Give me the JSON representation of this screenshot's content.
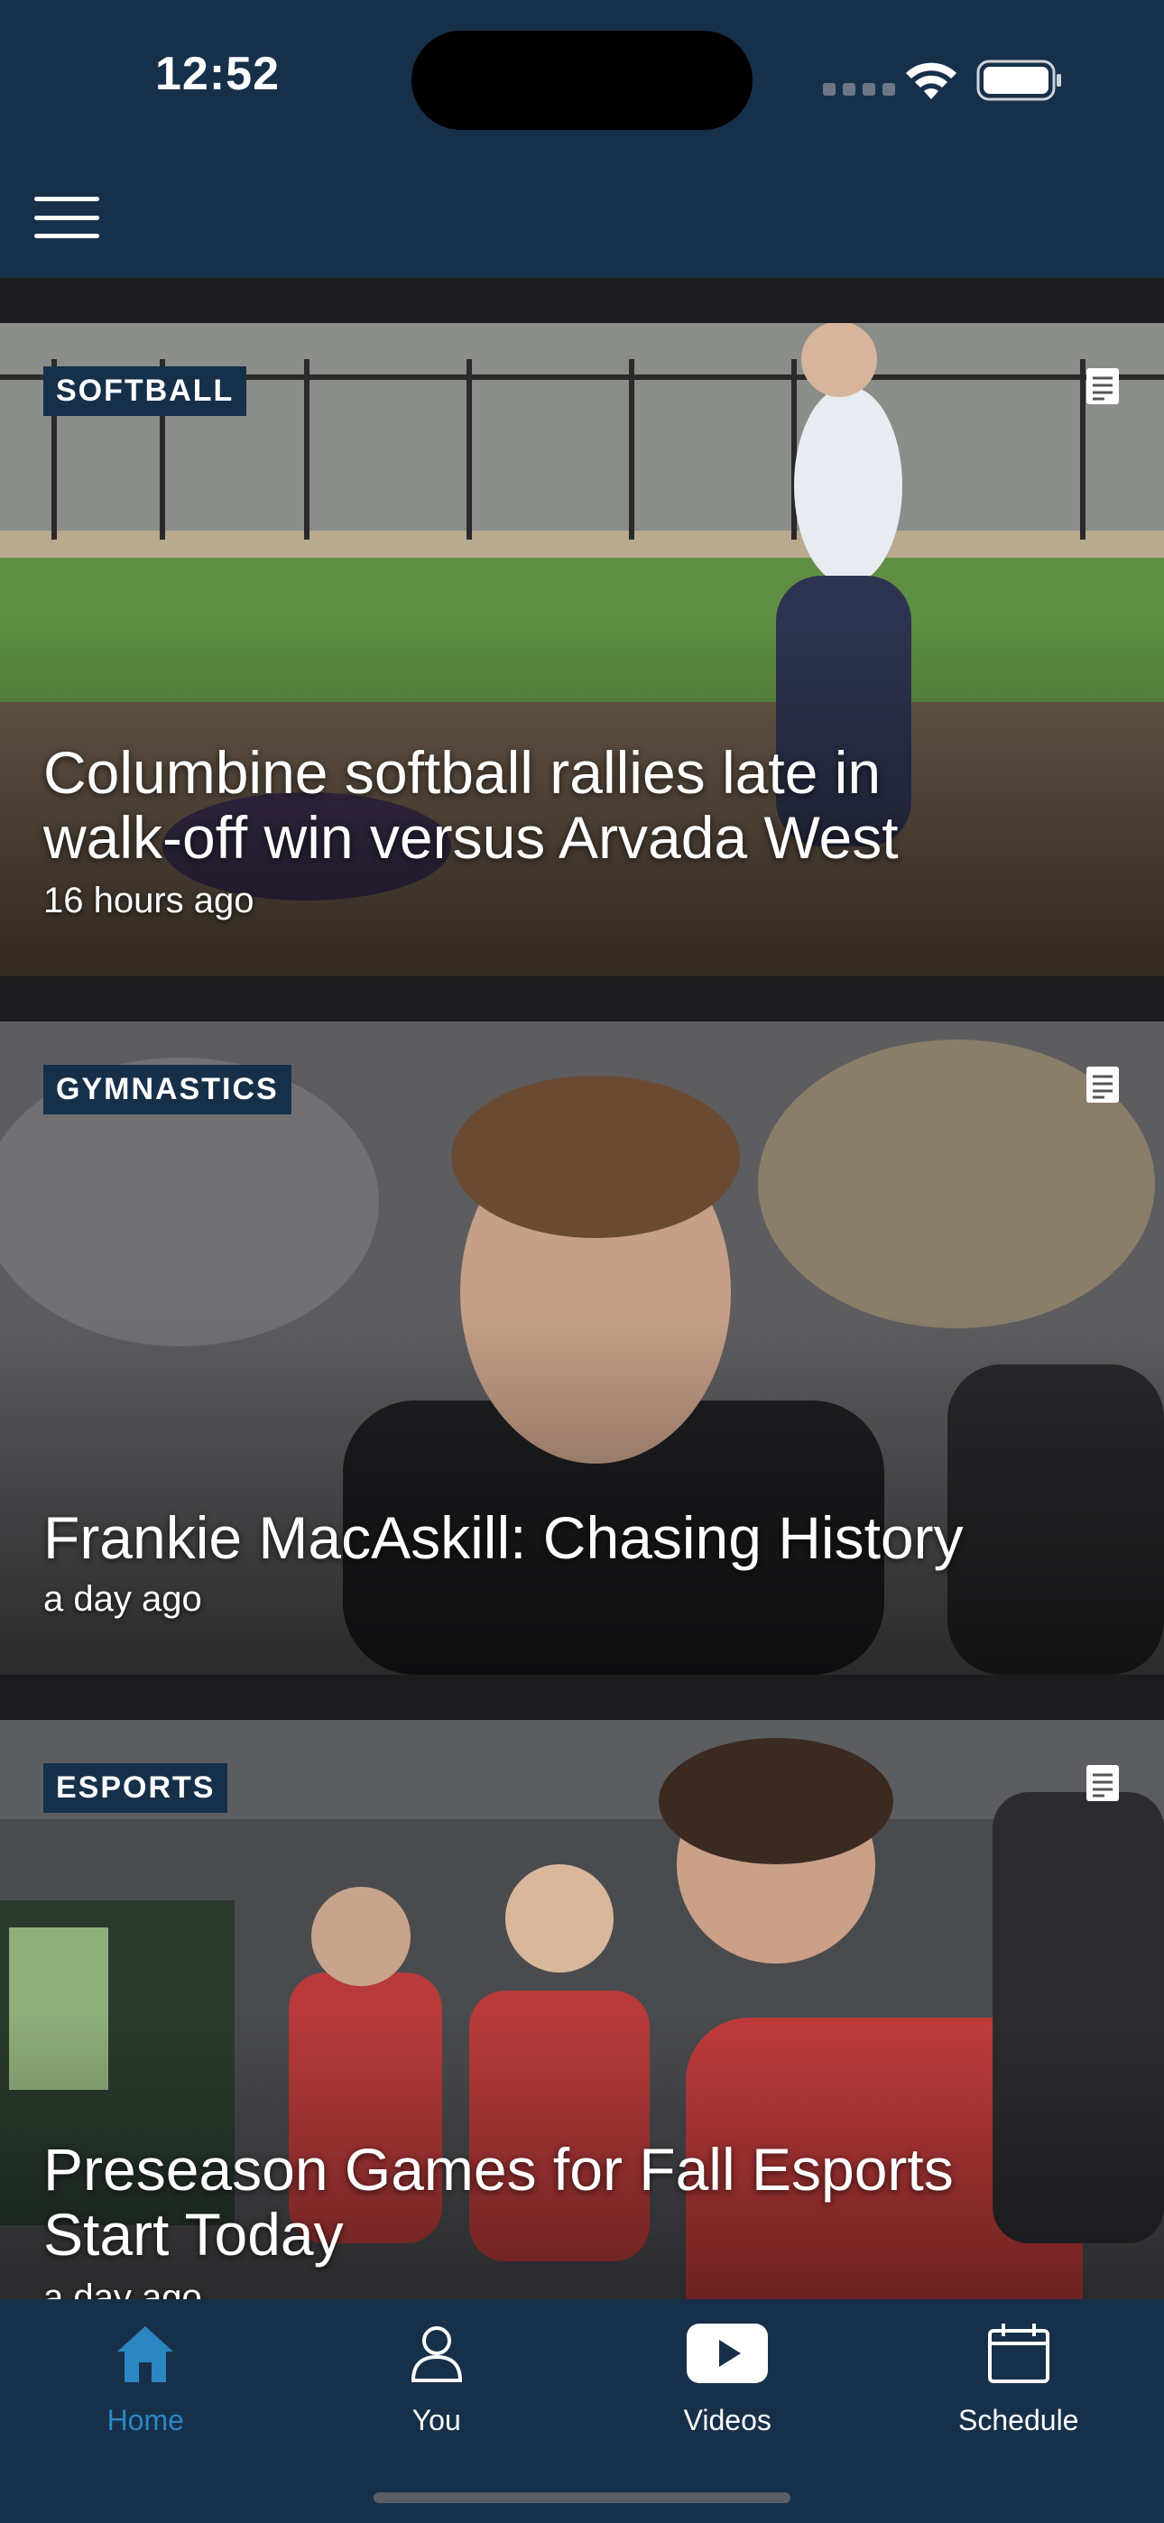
{
  "status_bar": {
    "time": "12:52"
  },
  "articles": [
    {
      "category": "SOFTBALL",
      "headline_lines": [
        "Columbine softball rallies late in",
        "walk-off win versus Arvada West"
      ],
      "timestamp": "16 hours ago"
    },
    {
      "category": "GYMNASTICS",
      "headline_lines": [
        "Frankie MacAskill: Chasing History"
      ],
      "timestamp": "a day ago"
    },
    {
      "category": "ESPORTS",
      "headline_lines": [
        "Preseason Games for Fall Esports",
        "Start Today"
      ],
      "timestamp": "a day ago"
    }
  ],
  "tabs": [
    {
      "label": "Home",
      "icon": "home-icon",
      "active": true
    },
    {
      "label": "You",
      "icon": "person-icon",
      "active": false
    },
    {
      "label": "Videos",
      "icon": "play-icon",
      "active": false
    },
    {
      "label": "Schedule",
      "icon": "calendar-icon",
      "active": false
    }
  ],
  "colors": {
    "header": "#17304a",
    "accent": "#2b86c2",
    "background": "#1c1c1e"
  }
}
